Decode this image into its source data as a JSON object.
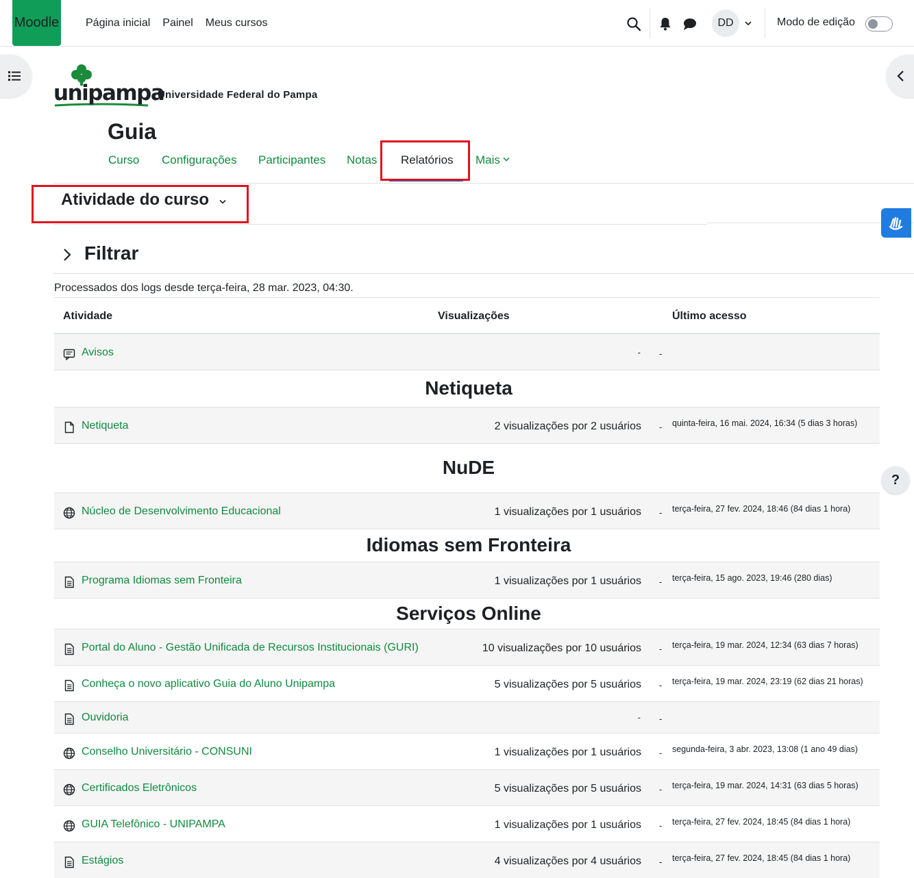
{
  "navbar": {
    "logo": "Moodle",
    "links": [
      "Página inicial",
      "Painel",
      "Meus cursos"
    ],
    "avatar": "DD",
    "edit_mode_label": "Modo de edição"
  },
  "brand": {
    "logo_text": "unipampa",
    "subtitle": "Universidade Federal do Pampa"
  },
  "course": {
    "title": "Guia",
    "tabs": [
      "Curso",
      "Configurações",
      "Participantes",
      "Notas",
      "Relatórios",
      "Mais"
    ],
    "active_tab": "Relatórios"
  },
  "report": {
    "title": "Atividade do curso",
    "filter_label": "Filtrar",
    "processed_text": "Processados dos logs desde terça-feira, 28 mar. 2023, 04:30.",
    "help_label": "?"
  },
  "table": {
    "headers": [
      "Atividade",
      "Visualizações",
      "Último acesso"
    ],
    "rows": [
      {
        "kind": "item",
        "icon": "forum-icon",
        "name": "Avisos",
        "views": "-",
        "dash": "-",
        "last": ""
      },
      {
        "kind": "section",
        "name": "Netiqueta"
      },
      {
        "kind": "item",
        "icon": "file-icon",
        "name": "Netiqueta",
        "views": "2 visualizações por 2 usuários",
        "dash": "-",
        "last": "quinta-feira, 16 mai. 2024, 16:34 (5 dias 3 horas)"
      },
      {
        "kind": "section",
        "name": "NuDE"
      },
      {
        "kind": "item",
        "icon": "globe-icon",
        "name": "Núcleo de Desenvolvimento Educacional",
        "views": "1 visualizações por 1 usuários",
        "dash": "-",
        "last": "terça-feira, 27 fev. 2024, 18:46 (84 dias 1 hora)"
      },
      {
        "kind": "section",
        "name": "Idiomas sem Fronteira"
      },
      {
        "kind": "item",
        "icon": "page-icon",
        "name": "Programa Idiomas sem Fronteira",
        "views": "1 visualizações por 1 usuários",
        "dash": "-",
        "last": "terça-feira, 15 ago. 2023, 19:46 (280 dias)"
      },
      {
        "kind": "section",
        "name": "Serviços Online"
      },
      {
        "kind": "item",
        "icon": "page-icon",
        "name": "Portal do Aluno - Gestão Unificada de Recursos Institucionais (GURI)",
        "views": "10 visualizações por 10 usuários",
        "dash": "-",
        "last": "terça-feira, 19 mar. 2024, 12:34 (63 dias 7 horas)"
      },
      {
        "kind": "item",
        "icon": "page-icon",
        "name": "Conheça o novo aplicativo Guia do Aluno Unipampa",
        "views": "5 visualizações por 5 usuários",
        "dash": "-",
        "last": "terça-feira, 19 mar. 2024, 23:19 (62 dias 21 horas)"
      },
      {
        "kind": "item",
        "icon": "page-icon",
        "name": "Ouvidoria",
        "views": "-",
        "dash": "-",
        "last": ""
      },
      {
        "kind": "item",
        "icon": "globe-icon",
        "name": "Conselho Universitário - CONSUNI",
        "views": "1 visualizações por 1 usuários",
        "dash": "-",
        "last": "segunda-feira, 3 abr. 2023, 13:08 (1 ano 49 dias)"
      },
      {
        "kind": "item",
        "icon": "globe-icon",
        "name": "Certificados Eletrônicos",
        "views": "5 visualizações por 5 usuários",
        "dash": "-",
        "last": "terça-feira, 19 mar. 2024, 14:31 (63 dias 5 horas)"
      },
      {
        "kind": "item",
        "icon": "globe-icon",
        "name": "GUIA Telefônico - UNIPAMPA",
        "views": "1 visualizações por 1 usuários",
        "dash": "-",
        "last": "terça-feira, 27 fev. 2024, 18:45 (84 dias 1 hora)"
      },
      {
        "kind": "item",
        "icon": "page-icon",
        "name": "Estágios",
        "views": "4 visualizações por 4 usuários",
        "dash": "-",
        "last": "terça-feira, 27 fev. 2024, 18:45 (84 dias 1 hora)"
      }
    ]
  },
  "colors": {
    "link": "#0f8a3e",
    "moodle_brand": "#0f9d58",
    "highlight": "#e0111e",
    "accessibility": "#1f7ce0"
  }
}
